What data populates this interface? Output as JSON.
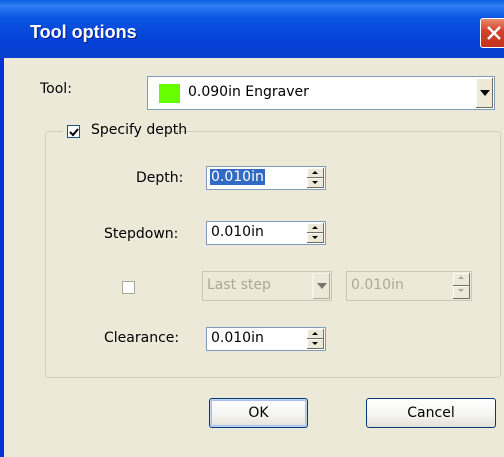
{
  "window": {
    "title": "Tool options"
  },
  "tool": {
    "label": "Tool:",
    "selected": "0.090in Engraver",
    "swatch_color": "#66ff00"
  },
  "group": {
    "label": "Specify depth",
    "checked": true
  },
  "depth": {
    "label": "Depth:",
    "value": "0.010in"
  },
  "stepdown": {
    "label": "Stepdown:",
    "value": "0.010in"
  },
  "last_step": {
    "checked": false,
    "mode": "Last step",
    "value": "0.010in"
  },
  "clearance": {
    "label": "Clearance:",
    "value": "0.010in"
  },
  "buttons": {
    "ok": "OK",
    "cancel": "Cancel"
  }
}
